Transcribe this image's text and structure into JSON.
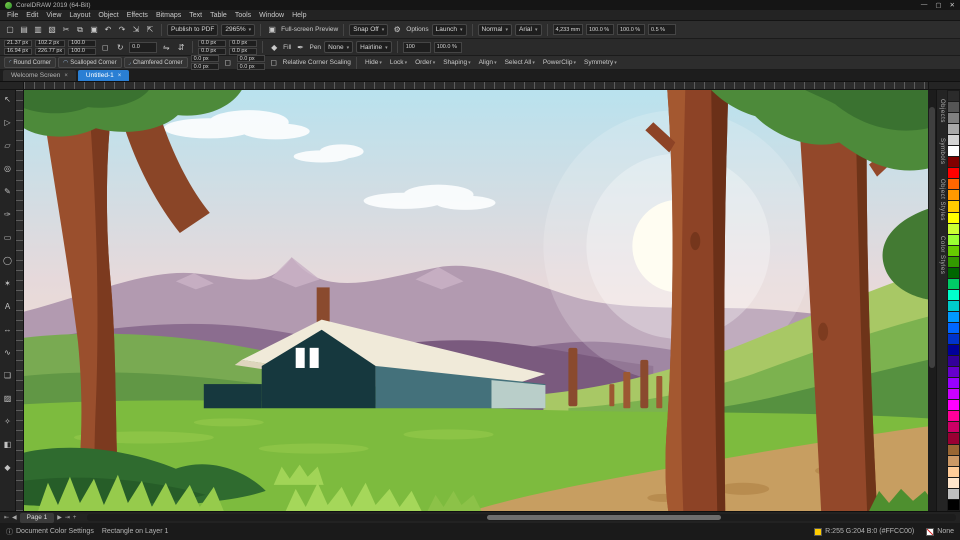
{
  "window": {
    "title": "CorelDRAW 2019 (64-Bit)",
    "minimize": "—",
    "maximize": "▢",
    "close": "✕"
  },
  "menu": {
    "items": [
      "File",
      "Edit",
      "View",
      "Layout",
      "Object",
      "Effects",
      "Bitmaps",
      "Text",
      "Table",
      "Tools",
      "Window",
      "Help"
    ]
  },
  "toolbar": {
    "icons": [
      {
        "name": "new-document",
        "glyph": "▢"
      },
      {
        "name": "open",
        "glyph": "▤"
      },
      {
        "name": "save",
        "glyph": "▥"
      },
      {
        "name": "print",
        "glyph": "▧"
      },
      {
        "name": "cut",
        "glyph": "✂"
      },
      {
        "name": "copy",
        "glyph": "⧉"
      },
      {
        "name": "paste",
        "glyph": "▣"
      },
      {
        "name": "undo",
        "glyph": "↶"
      },
      {
        "name": "redo",
        "glyph": "↷"
      },
      {
        "name": "import",
        "glyph": "⇲"
      },
      {
        "name": "export",
        "glyph": "⇱"
      }
    ],
    "publish_pdf_label": "Publish to PDF",
    "zoom_level": "2965%",
    "fullscreen_glyph": "▣",
    "fullscreen_label": "Full-screen Preview",
    "snap_label": "Snap Off",
    "options_glyph": "⚙",
    "options_label": "Options",
    "launch_label": "Launch",
    "quality_label": "Normal",
    "font_label": "Arial",
    "duplicate_distance": "4,233 mm",
    "scale_a": "100.0 %",
    "scale_b": "100.0 %",
    "end_value": "0.5 %"
  },
  "propbar": {
    "pos_x": "21.37 px",
    "pos_y": "16.94 px",
    "size_w": "102.2 px",
    "size_h": "226.77 px",
    "scale_w": "100.0",
    "scale_h": "100.0",
    "angle": "0.0",
    "radius_tl": "0.0 px",
    "radius_tr": "0.0 px",
    "radius_bl": "0.0 px",
    "radius_br": "0.0 px",
    "fill_label": "Fill",
    "pen_label": "Pen",
    "outline_style": "None",
    "outline_width": "Hairline",
    "num_100": "100",
    "opacity": "100.0 %",
    "icons": {
      "lock": "◻",
      "rotate": "↻",
      "mirror_h": "⇋",
      "mirror_v": "⇵",
      "fill": "◆",
      "pen": "✒"
    }
  },
  "cornerbar": {
    "buttons": [
      {
        "glyph": "◜",
        "label": "Round Corner"
      },
      {
        "glyph": "◠",
        "label": "Scalloped Corner"
      },
      {
        "glyph": "◞",
        "label": "Chamfered Corner"
      }
    ],
    "r1": "0.0 px",
    "r2": "0.0 px",
    "r3": "0.0 px",
    "r4": "0.0 px",
    "lock_glyph": "◻",
    "checkbox_glyph": "◻",
    "relative_label": "Relative Corner Scaling",
    "menus": [
      "Hide",
      "Lock",
      "Order",
      "Shaping",
      "Align",
      "Select All",
      "PowerClip",
      "Symmetry"
    ]
  },
  "tabs": [
    {
      "label": "Welcome Screen",
      "active": false
    },
    {
      "label": "Untitled-1",
      "active": true
    }
  ],
  "tab_close_glyph": "×",
  "toolbox": {
    "tools": [
      {
        "name": "pick",
        "glyph": "↖"
      },
      {
        "name": "shape",
        "glyph": "▷"
      },
      {
        "name": "crop",
        "glyph": "▱"
      },
      {
        "name": "zoom",
        "glyph": "◎"
      },
      {
        "name": "freehand",
        "glyph": "✎"
      },
      {
        "name": "artistic-media",
        "glyph": "✑"
      },
      {
        "name": "rectangle",
        "glyph": "▭"
      },
      {
        "name": "ellipse",
        "glyph": "◯"
      },
      {
        "name": "polygon",
        "glyph": "✶"
      },
      {
        "name": "text",
        "glyph": "A"
      },
      {
        "name": "parallel-dimension",
        "glyph": "↔"
      },
      {
        "name": "connector",
        "glyph": "∿"
      },
      {
        "name": "drop-shadow",
        "glyph": "❏"
      },
      {
        "name": "transparency",
        "glyph": "▨"
      },
      {
        "name": "color-eyedropper",
        "glyph": "✧"
      },
      {
        "name": "interactive-fill",
        "glyph": "◧"
      },
      {
        "name": "smart-fill",
        "glyph": "◆"
      }
    ]
  },
  "dockers": {
    "tabs": [
      "Objects",
      "Symbols",
      "Object Styles",
      "Color Styles"
    ]
  },
  "palette": {
    "colors": [
      "#2b2b2b",
      "#555555",
      "#808080",
      "#aaaaaa",
      "#d4d4d4",
      "#ffffff",
      "#800000",
      "#ff0000",
      "#ff6600",
      "#ff9900",
      "#ffcc00",
      "#ffff00",
      "#ccff33",
      "#99ff33",
      "#66cc00",
      "#339900",
      "#006600",
      "#00cc66",
      "#00ffcc",
      "#00cccc",
      "#0099ff",
      "#0066ff",
      "#0033cc",
      "#000099",
      "#330099",
      "#6600cc",
      "#9900ff",
      "#cc00ff",
      "#ff00ff",
      "#ff0099",
      "#cc0066",
      "#990033",
      "#996633",
      "#cc9966",
      "#ffcc99",
      "#ffe6cc",
      "#c0c0c0",
      "#000000"
    ]
  },
  "pagebar": {
    "first": "⇤",
    "prev": "◀",
    "page_label": "Page 1",
    "next": "▶",
    "last": "⇥",
    "add": "+"
  },
  "statusbar": {
    "info_icon": "ⓘ",
    "color_settings": "Document Color Settings",
    "selection": "Rectangle on Layer 1",
    "fill_text": "R:255 G:204 B:0 (#FFCC00)",
    "fill_color": "#FFCC00",
    "outline_label": "None"
  },
  "artwork": {
    "colors": {
      "sky_top": "#b9e2ee",
      "sky_mid": "#e6d9db",
      "sky_low": "#f4dfcb",
      "cloud": "#fbfdfe",
      "mtn_back": "#b29ab0",
      "mtn_hl": "#c9b2c5",
      "mtn_front": "#8b6d8f",
      "mtn_ridge": "#7a5a7e",
      "sun_core": "#fffdf2",
      "sun_glow": "#ffffff",
      "hill_light": "#a8c865",
      "hill_mid": "#7cb24f",
      "hill_dark": "#569140",
      "hill_left": "#79aa52",
      "hill_left_sh": "#619745",
      "field": "#7dbb3e",
      "path": "#c79e61",
      "path_spot": "#b68a4e",
      "roof": "#f0ead9",
      "roof_edge": "#ded5bd",
      "wall_dark": "#16383e",
      "wall_mid": "#44717b",
      "wall_light": "#b9cec9",
      "win": "#ffffff",
      "chimney": "#8a4a2e",
      "fence_a": "#8a4a2e",
      "fence_b": "#9c5832",
      "trunk_l": "#9a4f2d",
      "trunk_l_dark": "#7c3a1f",
      "branch": "#8a4527",
      "trunk_r": "#8d4326",
      "trunk_r_hl": "#a85c33",
      "trunk_r_dark": "#6b3018",
      "trunk_r2": "#93482a",
      "trunk_r2_dark": "#6e3419",
      "leaf": "#4d8a3a",
      "leaf_dark": "#3a7230",
      "leaf_mid": "#437a33",
      "bush": "#2f6b2f",
      "bush_dark": "#265d28",
      "tuft1": "#96cb4c",
      "tuft2": "#a5d75a",
      "tuft3": "#8cc248",
      "tuft_dark": "#4e8f2f",
      "streak": "#93c84a"
    }
  }
}
